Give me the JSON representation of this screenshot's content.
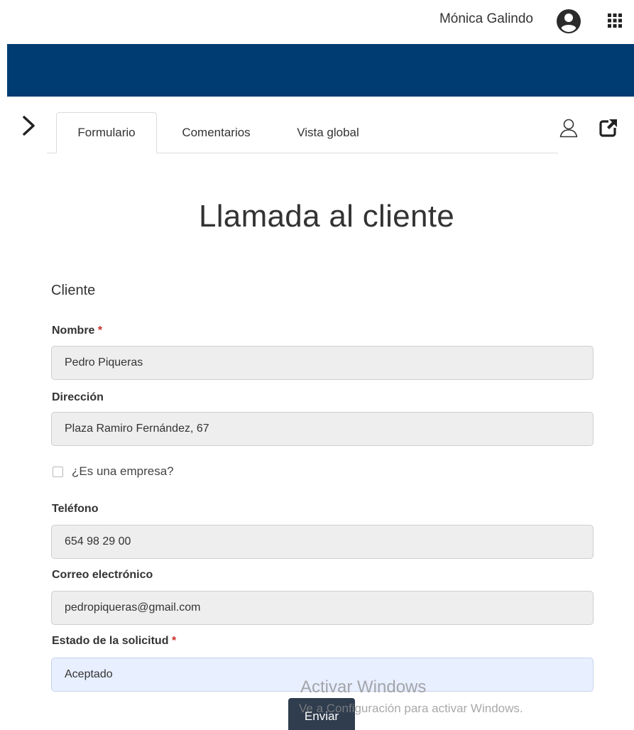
{
  "header": {
    "user_name": "Mónica Galindo",
    "avatar_icon": "user-circle-icon",
    "apps_icon": "apps-grid-icon"
  },
  "colors": {
    "brand_band": "#003c71",
    "submit_button": "#2f3d4e",
    "required_mark": "#c9302c",
    "select_field": "#e8efff"
  },
  "tabs": {
    "items": [
      {
        "label": "Formulario",
        "active": true
      },
      {
        "label": "Comentarios",
        "active": false
      },
      {
        "label": "Vista global",
        "active": false
      }
    ],
    "expand_icon": "chevron-right-icon",
    "person_icon": "person-outline-icon",
    "open_external_icon": "external-link-icon"
  },
  "form": {
    "title": "Llamada al cliente",
    "section": "Cliente",
    "nombre": {
      "label": "Nombre",
      "required_mark": "*",
      "value": "Pedro Piqueras"
    },
    "direccion": {
      "label": "Dirección",
      "value": "Plaza Ramiro Fernández, 67"
    },
    "empresa": {
      "label": "¿Es una empresa?",
      "checked": false
    },
    "telefono": {
      "label": "Teléfono",
      "value": "654 98 29 00"
    },
    "correo": {
      "label": "Correo electrónico",
      "value": "pedropiqueras@gmail.com"
    },
    "estado": {
      "label": "Estado de la solicitud",
      "required_mark": "*",
      "value": "Aceptado"
    },
    "submit_label": "Enviar"
  },
  "watermark": {
    "title": "Activar Windows",
    "subtitle": "Ve a Configuración para activar Windows."
  }
}
